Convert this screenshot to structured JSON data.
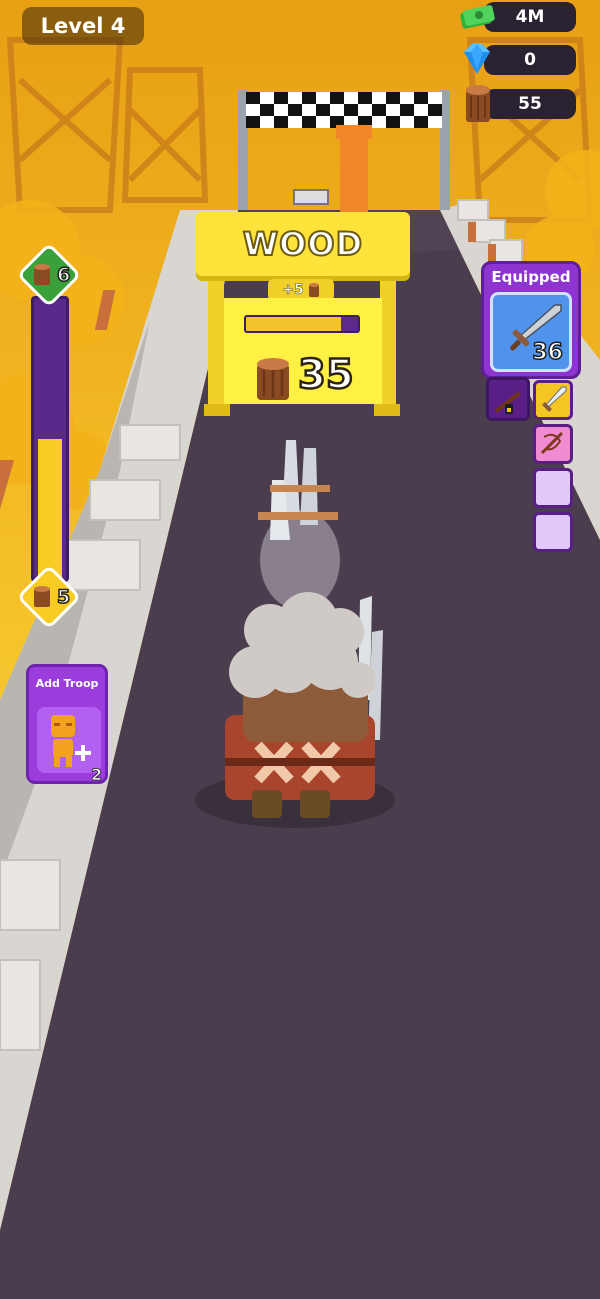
{
  "hud": {
    "level": "Level 4",
    "cash": "4M",
    "gems": "0",
    "wood": "55"
  },
  "gate": {
    "title": "WOOD",
    "bonus": "+5",
    "count": "35",
    "progress": 0.85
  },
  "meter": {
    "top_value": "6",
    "bottom_value": "5",
    "fill": 0.5
  },
  "troop": {
    "title": "Add Troop",
    "count": "2"
  },
  "equipped": {
    "title": "Equipped",
    "count": "36",
    "weapon": "sword-icon",
    "slots": [
      "rifle-icon-locked",
      "sword-icon",
      "crossbow-icon",
      "empty",
      "empty"
    ]
  },
  "colors": {
    "sky": "#f2b21a",
    "road": "#4a3d4d",
    "gate_yellow": "#ffe33a",
    "purple": "#8d34d1",
    "meter_green": "#3aa03a"
  }
}
